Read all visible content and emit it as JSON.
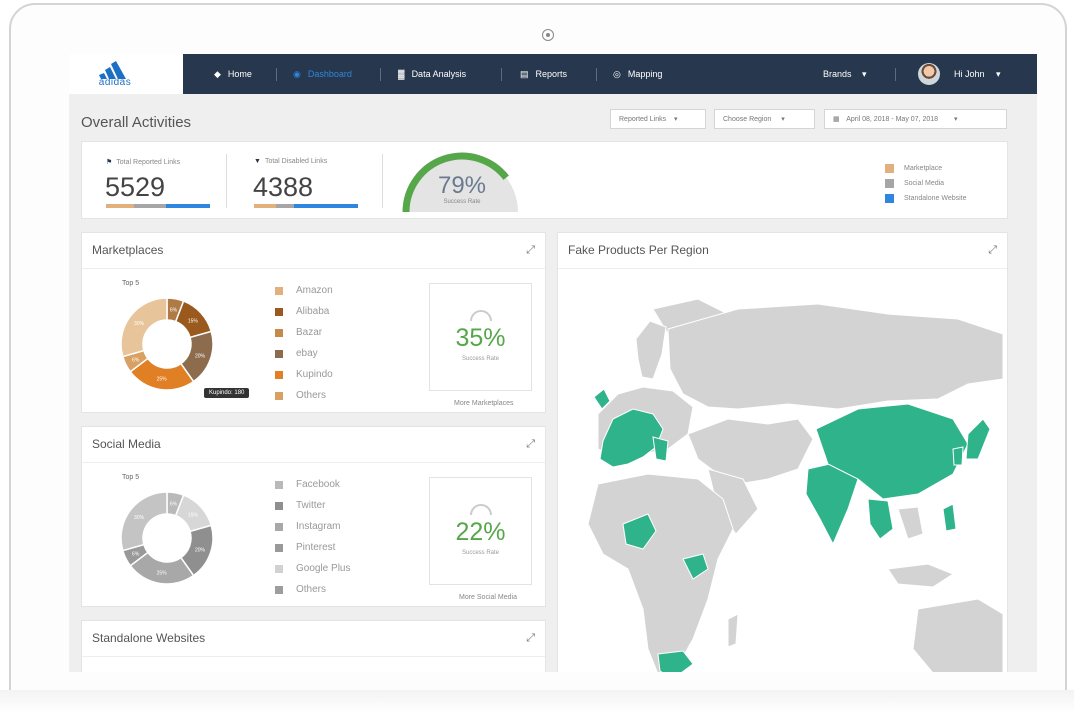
{
  "brand": {
    "logo_text": "adidas"
  },
  "nav": {
    "items": [
      {
        "label": "Home",
        "icon": "home-icon",
        "glyph": "◆"
      },
      {
        "label": "Dashboard",
        "icon": "dashboard-icon",
        "glyph": "◉"
      },
      {
        "label": "Data Analysis",
        "icon": "chart-icon",
        "glyph": "▓"
      },
      {
        "label": "Reports",
        "icon": "report-icon",
        "glyph": "▤"
      },
      {
        "label": "Mapping",
        "icon": "target-icon",
        "glyph": "◎"
      }
    ],
    "active": "Dashboard",
    "brands_label": "Brands",
    "user_label": "Hi John",
    "caret": "▾"
  },
  "page": {
    "title": "Overall Activities",
    "filters": {
      "reported_links": "Reported Links",
      "choose_region": "Choose Region",
      "date_range": "April 08, 2018 - May 07, 2018"
    }
  },
  "stats": {
    "reported": {
      "label": "Total Reported Links",
      "value": "5529"
    },
    "disabled": {
      "label": "Total Disabled Links",
      "value": "4388"
    },
    "success": {
      "value": "79%",
      "label": "Success Rate",
      "fraction": 0.79
    },
    "legend": [
      "Marketplace",
      "Social Media",
      "Standalone Website"
    ]
  },
  "colors": {
    "navbar": "#27374d",
    "marketplace": "#e2b07c",
    "social": "#a6a6a6",
    "standalone": "#2e86de",
    "success_green": "#56a64a",
    "map_highlight": "#2fb38a"
  },
  "marketplaces": {
    "title": "Marketplaces",
    "top_label": "Top 5",
    "items": [
      "Amazon",
      "Alibaba",
      "Bazar",
      "ebay",
      "Kupindo",
      "Others"
    ],
    "slice_labels": [
      "6%",
      "15%",
      "20%",
      "25%",
      "6%",
      "30%"
    ],
    "tooltip": "Kupindo: 180",
    "rate": "35%",
    "rate_label": "Success Rate",
    "more": "More Marketplaces"
  },
  "social_media": {
    "title": "Social Media",
    "top_label": "Top 5",
    "items": [
      "Facebook",
      "Twitter",
      "Instagram",
      "Pinterest",
      "Google Plus",
      "Others"
    ],
    "slice_labels": [
      "6%",
      "15%",
      "20%",
      "25%",
      "6%",
      "30%"
    ],
    "rate": "22%",
    "rate_label": "Success Rate",
    "more": "More Social Media"
  },
  "standalone": {
    "title": "Standalone Websites"
  },
  "map": {
    "title": "Fake Products Per Region"
  }
}
